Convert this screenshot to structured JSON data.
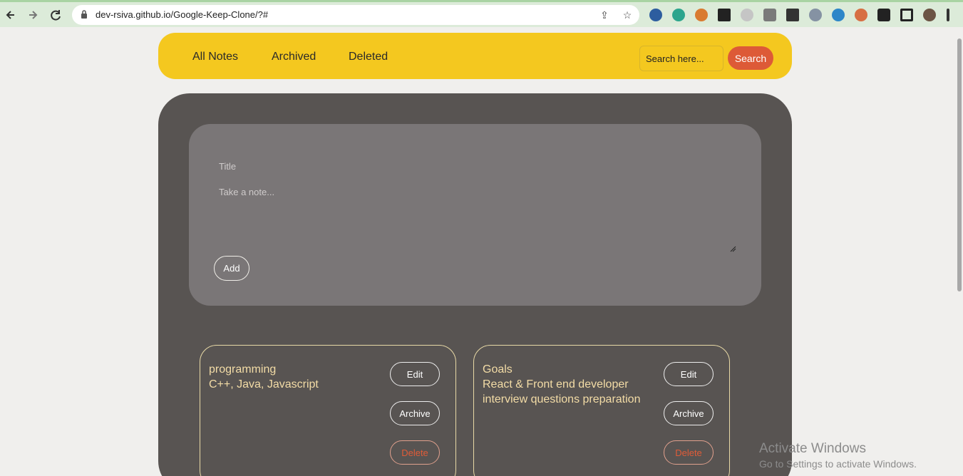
{
  "browser": {
    "url": "dev-rsiva.github.io/Google-Keep-Clone/?#"
  },
  "header": {
    "nav": [
      "All Notes",
      "Archived",
      "Deleted"
    ],
    "search_placeholder": "Search here...",
    "search_label": "Search"
  },
  "composer": {
    "title_placeholder": "Title",
    "note_placeholder": "Take a note...",
    "add_label": "Add"
  },
  "notes": [
    {
      "title": "programming",
      "body": "C++, Java, Javascript",
      "edit_label": "Edit",
      "archive_label": "Archive",
      "delete_label": "Delete"
    },
    {
      "title": "Goals",
      "body": "React & Front end developer interview questions preparation",
      "edit_label": "Edit",
      "archive_label": "Archive",
      "delete_label": "Delete"
    }
  ],
  "watermark": {
    "title": "Activate Windows",
    "subtitle": "Go to Settings to activate Windows."
  },
  "colors": {
    "header_bg": "#f4c81f",
    "main_bg": "#585452",
    "composer_bg": "#7a7677",
    "accent": "#dd5a37",
    "note_text": "#f3dca6"
  },
  "icons": [
    "back-arrow-icon",
    "forward-arrow-icon",
    "reload-icon",
    "lock-icon",
    "share-icon",
    "star-icon",
    "extension-icons",
    "puzzle-icon",
    "side-panel-icon",
    "profile-avatar",
    "menu-dots-icon"
  ]
}
